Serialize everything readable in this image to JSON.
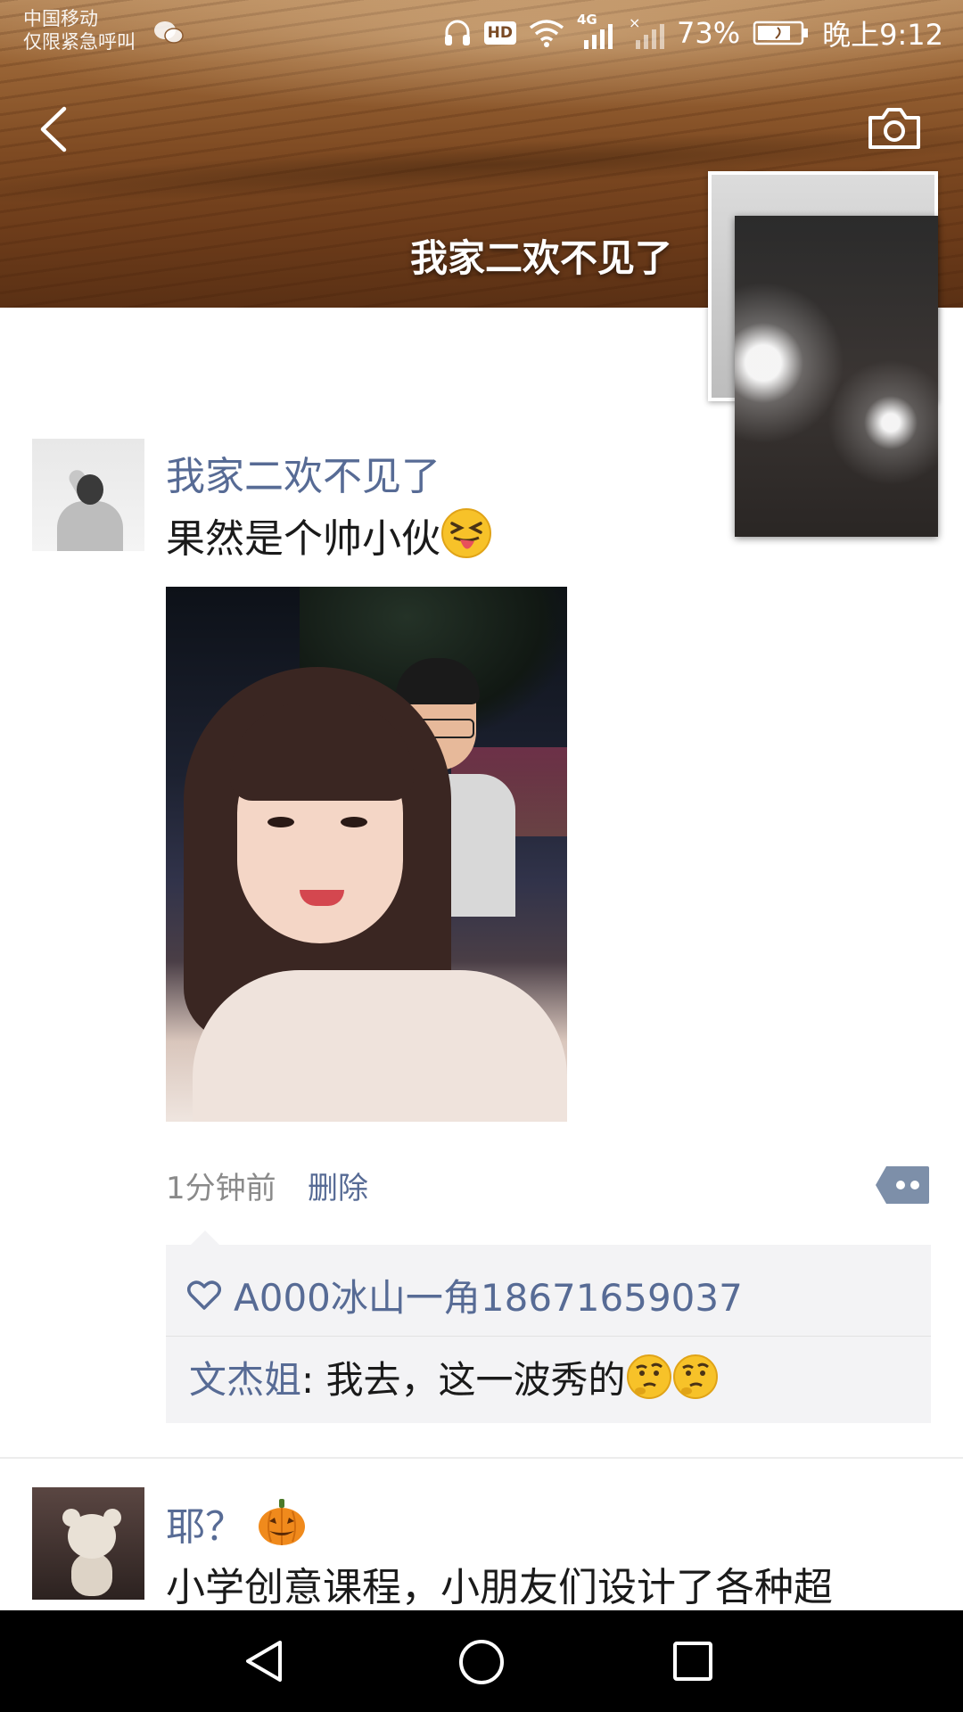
{
  "status_bar": {
    "carrier": "中国移动",
    "carrier_sub": "仅限紧急呼叫",
    "battery": "73%",
    "time": "晚上9:12",
    "hd_label": "HD",
    "network": "4G"
  },
  "header": {
    "profile_name": "我家二欢不见了"
  },
  "posts": [
    {
      "nickname": "我家二欢不见了",
      "text": "果然是个帅小伙",
      "emoji": "squinting-tongue-emoji",
      "time_ago": "1分钟前",
      "delete_label": "删除",
      "likes": "A000冰山一角18671659037",
      "comments": [
        {
          "name": "文杰姐",
          "separator": ": ",
          "text": "我去，这一波秀的"
        }
      ]
    },
    {
      "nickname": "耶？",
      "text": "小学创意课程，小朋友们设计了各种超",
      "emoji": "pumpkin-emoji"
    }
  ],
  "colors": {
    "link_blue": "#576b95",
    "comment_bg": "#f3f3f5"
  }
}
